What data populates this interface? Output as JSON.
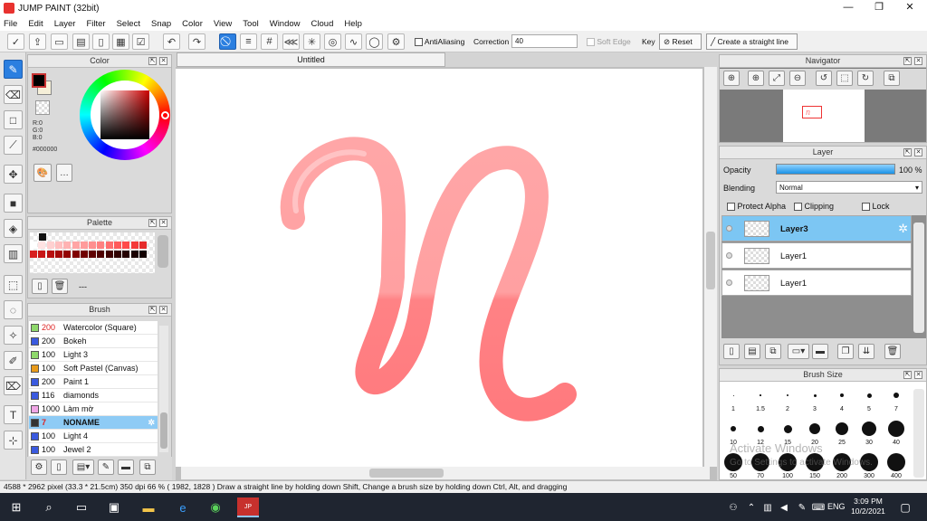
{
  "app": {
    "title": "JUMP PAINT (32bit)"
  },
  "window_controls": {
    "minimize": "—",
    "maximize": "❐",
    "close": "✕"
  },
  "menu": [
    "File",
    "Edit",
    "Layer",
    "Filter",
    "Select",
    "Snap",
    "Color",
    "View",
    "Tool",
    "Window",
    "Cloud",
    "Help"
  ],
  "toolbar": {
    "antialiasing_label": "AntiAliasing",
    "correction_label": "Correction",
    "correction_value": "40",
    "soft_edge_label": "Soft Edge",
    "key_label": "Key",
    "reset_label": "Reset",
    "straight_line_label": "Create a straight line"
  },
  "color_panel": {
    "title": "Color",
    "r": "R:0",
    "g": "G:0",
    "b": "B:0",
    "hex": "#000000",
    "fg": "#000000",
    "bg": "#f5efd8"
  },
  "palette_panel": {
    "title": "Palette",
    "dash": "---",
    "swatches": [
      "#111111",
      "#ffffff",
      "#ffe3e3",
      "#ffd0d0",
      "#ffc0c0",
      "#ffb3b3",
      "#ffa5a5",
      "#ff9b9b",
      "#ff8f8f",
      "#ff8080",
      "#ff6e6e",
      "#ff5a5a",
      "#ff4a4a",
      "#f43a3a",
      "#e62b2b",
      "#d81f1f",
      "#c81515",
      "#b80e0e",
      "#a50808",
      "#930404",
      "#800000",
      "#700000",
      "#600000",
      "#4f0000",
      "#3f0000",
      "#300000",
      "#250000",
      "#1a0000",
      "#120000"
    ]
  },
  "brush_panel": {
    "title": "Brush",
    "items": [
      {
        "color": "#8ed86b",
        "size": "200",
        "name": "Watercolor (Square)",
        "red": true
      },
      {
        "color": "#3a5adf",
        "size": "200",
        "name": "Bokeh"
      },
      {
        "color": "#8ed86b",
        "size": "100",
        "name": "Light 3"
      },
      {
        "color": "#e89a1a",
        "size": "100",
        "name": "Soft Pastel (Canvas)"
      },
      {
        "color": "#3a5adf",
        "size": "200",
        "name": "Paint 1"
      },
      {
        "color": "#3a5adf",
        "size": "116",
        "name": "diamonds"
      },
      {
        "color": "#f0a6e6",
        "size": "1000",
        "name": "Làm mờ"
      },
      {
        "color": "#333333",
        "size": "7",
        "name": "NONAME",
        "selected": true
      },
      {
        "color": "#3a5adf",
        "size": "100",
        "name": "Light 4"
      },
      {
        "color": "#3a5adf",
        "size": "100",
        "name": "Jewel 2"
      }
    ]
  },
  "canvas": {
    "tab": "Untitled",
    "stroke_color": "#ff7a7e"
  },
  "navigator_panel": {
    "title": "Navigator"
  },
  "layer_panel": {
    "title": "Layer",
    "opacity_label": "Opacity",
    "opacity_value": "100 %",
    "opacity": 1.0,
    "blending_label": "Blending",
    "blending_value": "Normal",
    "protect_alpha": "Protect Alpha",
    "clipping": "Clipping",
    "lock": "Lock",
    "layers": [
      {
        "name": "Layer3",
        "selected": true
      },
      {
        "name": "Layer1"
      },
      {
        "name": "Layer1"
      }
    ]
  },
  "brushsize_panel": {
    "title": "Brush Size",
    "row1": [
      "1",
      "1.5",
      "2",
      "3",
      "4",
      "5",
      "7"
    ],
    "row2": [
      "10",
      "12",
      "15",
      "20",
      "25",
      "30",
      "40"
    ],
    "row3": [
      "50",
      "70",
      "100",
      "150",
      "200",
      "300",
      "400"
    ]
  },
  "watermark": {
    "line1": "Activate Windows",
    "line2": "Go to Settings to activate Windows."
  },
  "status": {
    "text": "4588 * 2962 pixel   (33.3 * 21.5cm)   350 dpi   66 %   ( 1982, 1828 )   Draw a straight line by holding down Shift, Change a brush size by holding down Ctrl, Alt, and dragging"
  },
  "taskbar": {
    "time": "3:09 PM",
    "date": "10/2/2021",
    "lang": "ENG"
  }
}
